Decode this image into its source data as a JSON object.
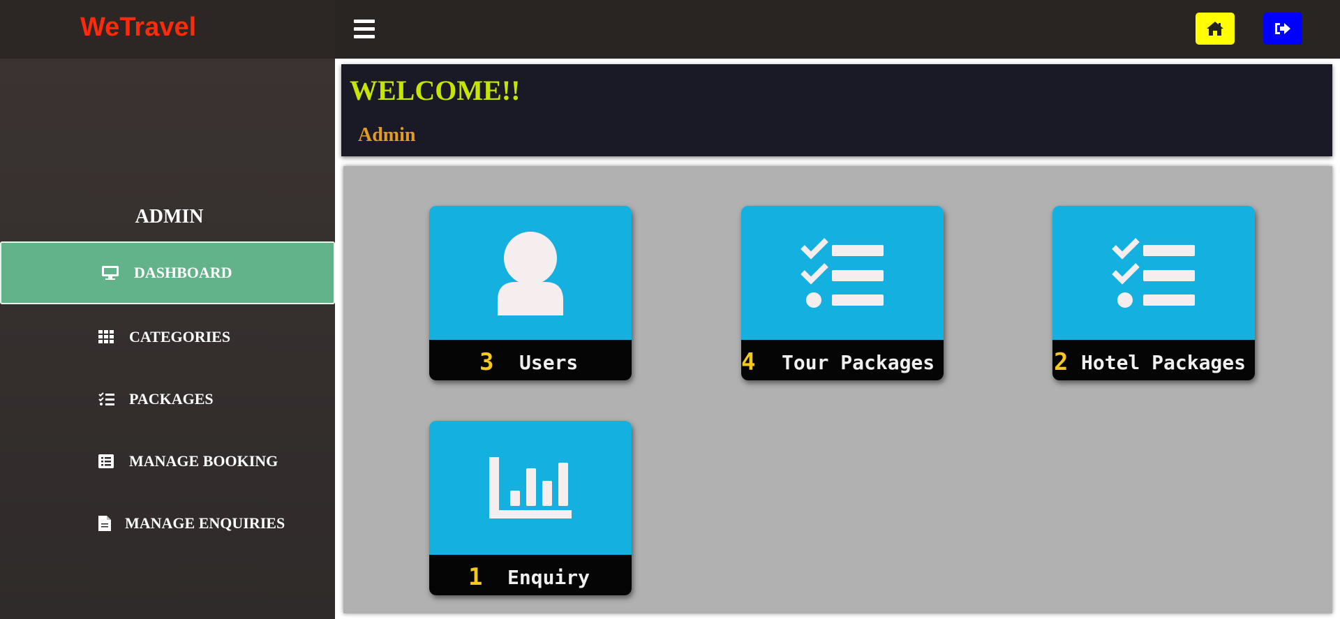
{
  "header": {
    "brand": "WeTravel",
    "home_icon": "home-icon",
    "logout_icon": "sign-out-icon",
    "home_color": "#ffff00",
    "logout_color": "#0000ff"
  },
  "sidebar": {
    "heading": "ADMIN",
    "items": [
      {
        "label": "DASHBOARD",
        "icon": "monitor-icon",
        "active": true
      },
      {
        "label": "CATEGORIES",
        "icon": "grid-icon"
      },
      {
        "label": "PACKAGES",
        "icon": "checklist-icon"
      },
      {
        "label": "MANAGE BOOKING",
        "icon": "list-alt-icon"
      },
      {
        "label": "MANAGE ENQUIRIES",
        "icon": "file-icon"
      }
    ],
    "active_color": "#63b38a"
  },
  "welcome": {
    "title": "WELCOME!!",
    "user": "Admin"
  },
  "cards": [
    {
      "count": "3",
      "label": "Users",
      "icon": "user-icon"
    },
    {
      "count": "4",
      "label": "Tour Packages",
      "icon": "checklist-icon"
    },
    {
      "count": "2",
      "label": "Hotel Packages",
      "icon": "checklist-icon"
    },
    {
      "count": "1",
      "label": "Enquiry",
      "icon": "bar-chart-icon"
    }
  ],
  "colors": {
    "card_top": "#14b0e0",
    "count": "#f2c91c",
    "brand": "#ff2a0a",
    "welcome_title": "#c6e500",
    "welcome_user": "#e39c23"
  }
}
